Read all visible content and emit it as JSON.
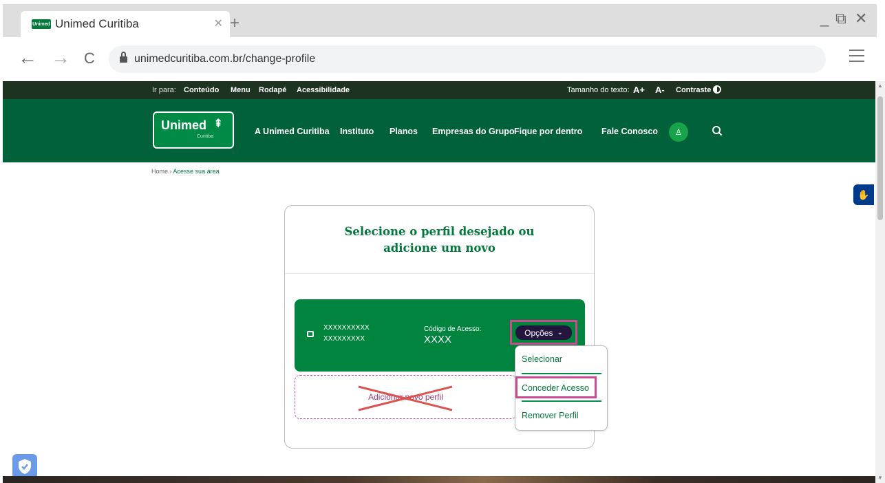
{
  "browser": {
    "tab_title": "Unimed Curitiba",
    "favicon_text": "Unimed",
    "url": "unimedcuritiba.com.br/change-profile"
  },
  "topbar": {
    "goto_label": "Ir para:",
    "links": [
      "Conteúdo",
      "Menu",
      "Rodapé",
      "Acessibilidade"
    ],
    "text_size_label": "Tamanho do texto:",
    "increase": "A+",
    "decrease": "A-",
    "contrast": "Contraste"
  },
  "logo": {
    "brand": "Unimed",
    "sub": "Curitiba"
  },
  "nav": {
    "items": [
      "A Unimed Curitiba",
      "Instituto",
      "Planos",
      "Empresas do Grupo",
      "Fique por dentro",
      "Fale Conosco"
    ]
  },
  "breadcrumb": {
    "home": "Home",
    "sep": "›",
    "current": "Acesse sua área"
  },
  "card": {
    "title_line1": "Selecione o perfil desejado ou",
    "title_line2": "adicione um novo",
    "profile": {
      "name_line1": "XXXXXXXXXX",
      "name_line2": "XXXXXXXXX",
      "code_label": "Código de Acesso:",
      "code_value": "XXXX",
      "options_label": "Opções",
      "options_caret": "⌄"
    },
    "add_profile_label": "Adicionar novo perfil"
  },
  "dropdown": {
    "items": [
      "Selecionar",
      "Conceder Acesso",
      "Remover Perfil"
    ]
  },
  "colors": {
    "brand_green": "#00613a",
    "card_green": "#00843e",
    "highlight": "#cc4a91",
    "cross": "#d9534f"
  }
}
